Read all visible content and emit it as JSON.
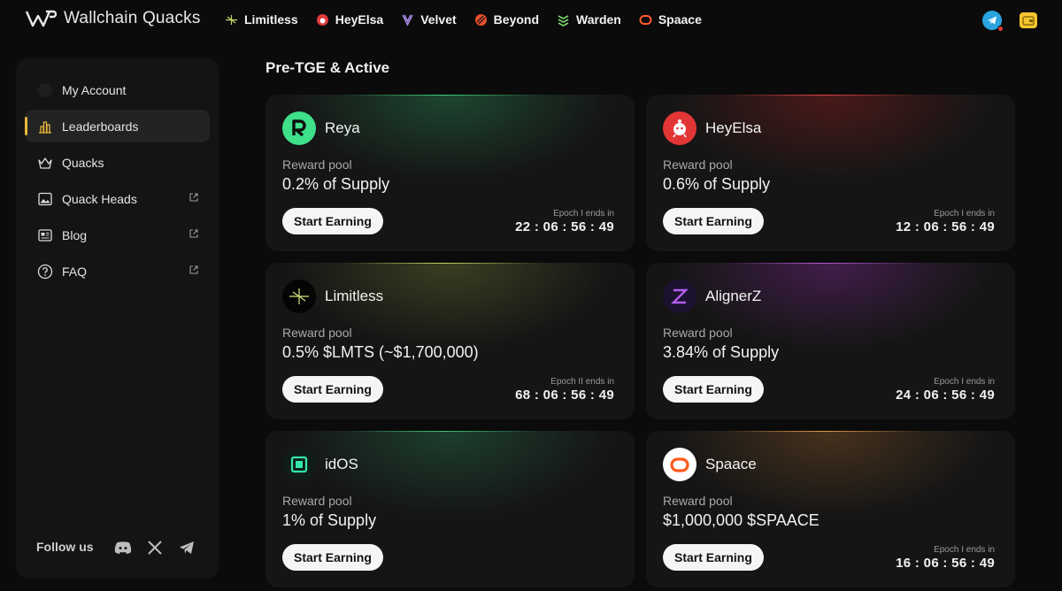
{
  "app": {
    "name": "Wallchain Quacks"
  },
  "nav": {
    "links": [
      {
        "label": "Limitless",
        "icon": "limitless-icon"
      },
      {
        "label": "HeyElsa",
        "icon": "heyelsa-icon"
      },
      {
        "label": "Velvet",
        "icon": "velvet-icon"
      },
      {
        "label": "Beyond",
        "icon": "beyond-icon"
      },
      {
        "label": "Warden",
        "icon": "warden-icon"
      },
      {
        "label": "Spaace",
        "icon": "spaace-icon"
      }
    ],
    "right_icons": [
      "telegram-icon",
      "wallet-icon"
    ]
  },
  "sidebar": {
    "items": [
      {
        "label": "My Account",
        "icon": "user-icon",
        "active": false,
        "external": false
      },
      {
        "label": "Leaderboards",
        "icon": "bar-chart-icon",
        "active": true,
        "external": false
      },
      {
        "label": "Quacks",
        "icon": "basket-icon",
        "active": false,
        "external": false
      },
      {
        "label": "Quack Heads",
        "icon": "image-icon",
        "active": false,
        "external": true
      },
      {
        "label": "Blog",
        "icon": "newspaper-icon",
        "active": false,
        "external": true
      },
      {
        "label": "FAQ",
        "icon": "question-icon",
        "active": false,
        "external": true
      }
    ],
    "follow_label": "Follow us",
    "socials": [
      "discord-icon",
      "x-icon",
      "telegram-icon"
    ]
  },
  "main": {
    "section_title": "Pre-TGE & Active",
    "cards": [
      {
        "name": "Reya",
        "pool_label": "Reward pool",
        "pool_value": "0.2% of Supply",
        "button": "Start Earning",
        "epoch_label": "Epoch I ends in",
        "epoch_time": "22 : 06 : 56 : 49",
        "glow": "#1f6b3f"
      },
      {
        "name": "HeyElsa",
        "pool_label": "Reward pool",
        "pool_value": "0.6% of Supply",
        "button": "Start Earning",
        "epoch_label": "Epoch I ends in",
        "epoch_time": "12 : 06 : 56 : 49",
        "glow": "#6b1f1f"
      },
      {
        "name": "Limitless",
        "pool_label": "Reward pool",
        "pool_value": "0.5% $LMTS (~$1,700,000)",
        "button": "Start Earning",
        "epoch_label": "Epoch II ends in",
        "epoch_time": "68 : 06 : 56 : 49",
        "glow": "#4d5a24"
      },
      {
        "name": "AlignerZ",
        "pool_label": "Reward pool",
        "pool_value": "3.84% of Supply",
        "button": "Start Earning",
        "epoch_label": "Epoch I ends in",
        "epoch_time": "24 : 06 : 56 : 49",
        "glow": "#5a1f6b"
      },
      {
        "name": "idOS",
        "pool_label": "Reward pool",
        "pool_value": "1% of Supply",
        "button": "Start Earning",
        "epoch_label": "",
        "epoch_time": "",
        "glow": "#1f5a3a"
      },
      {
        "name": "Spaace",
        "pool_label": "Reward pool",
        "pool_value": "$1,000,000 $SPAACE",
        "button": "Start Earning",
        "epoch_label": "Epoch I ends in",
        "epoch_time": "16 : 06 : 56 : 49",
        "glow": "#6b451f"
      }
    ]
  }
}
